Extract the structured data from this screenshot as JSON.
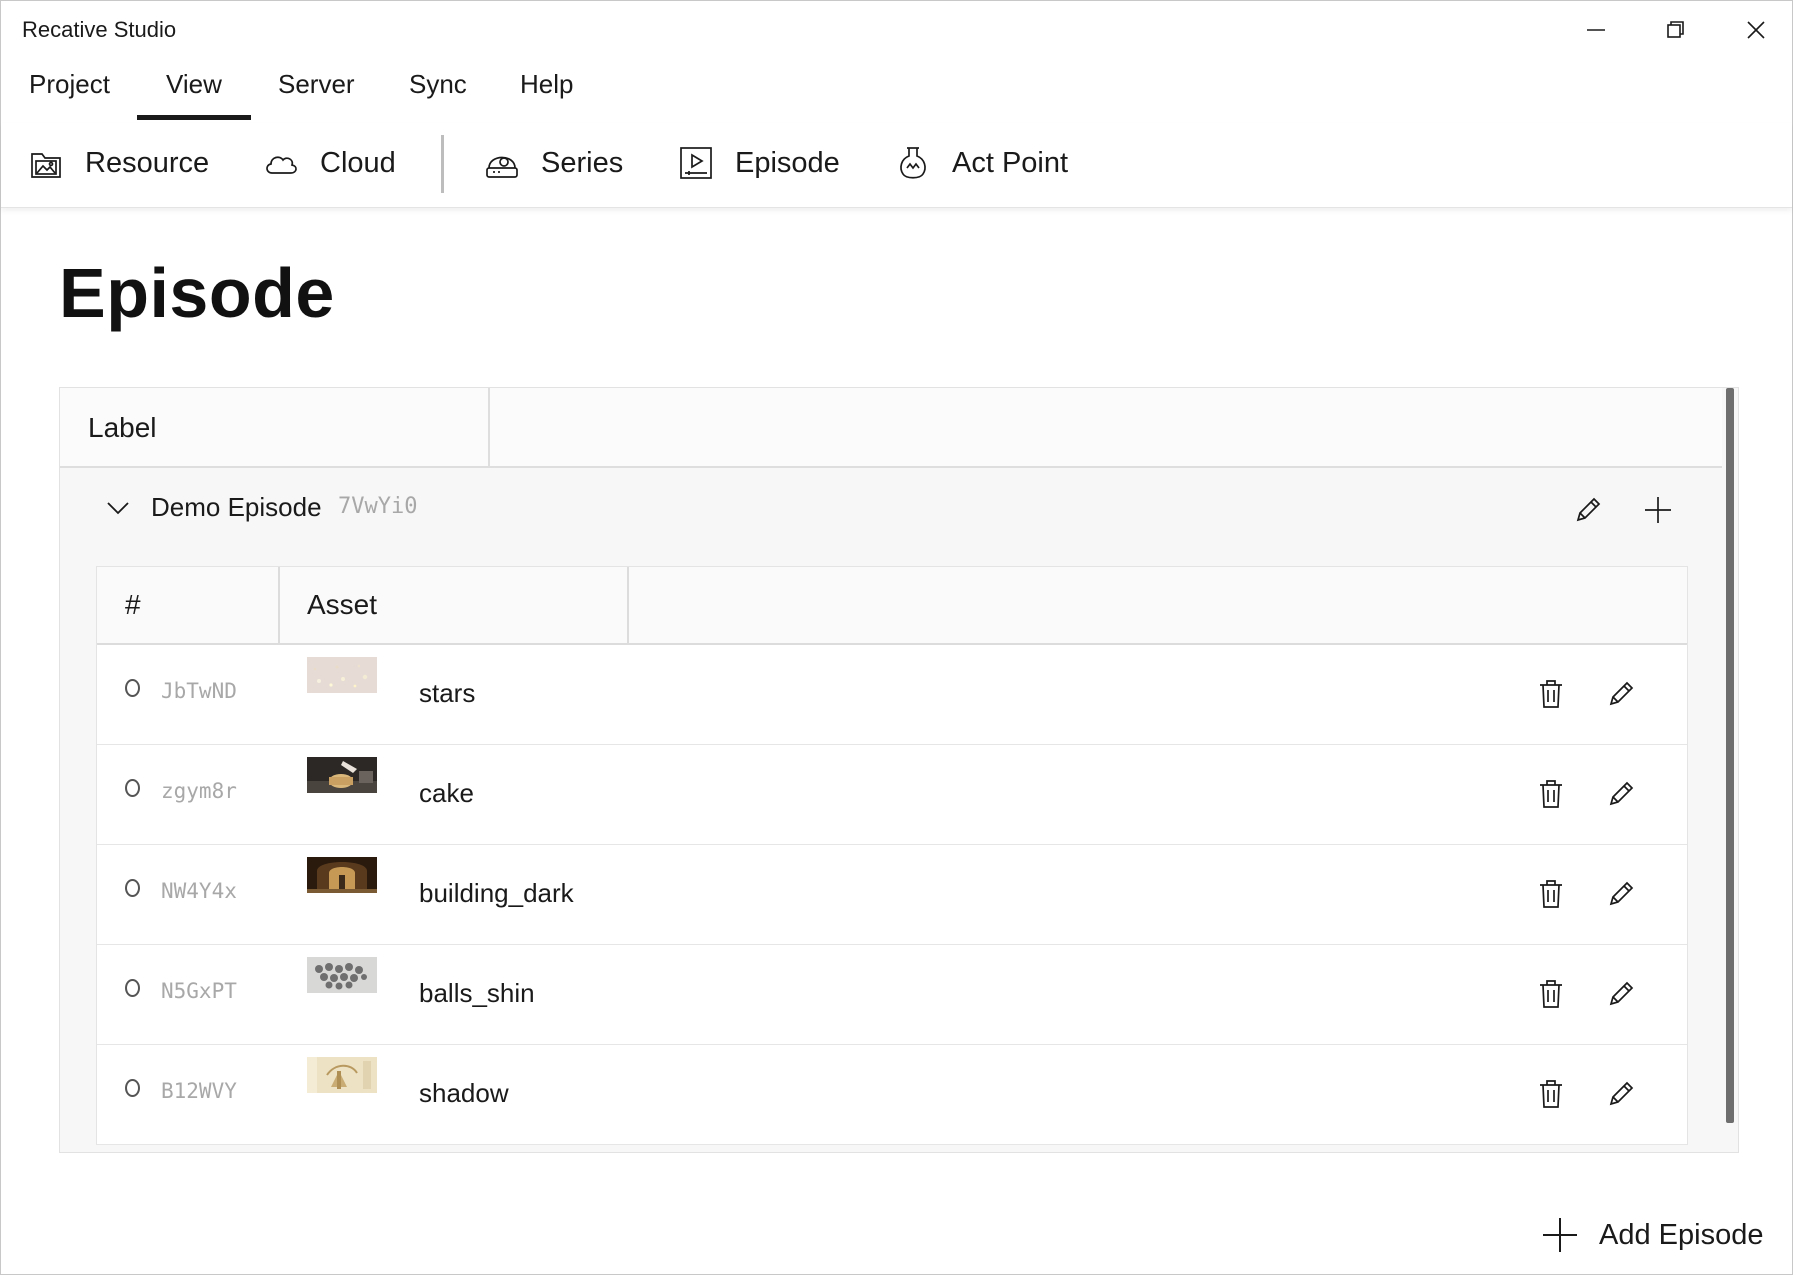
{
  "window": {
    "title": "Recative Studio"
  },
  "menu": {
    "items": [
      "Project",
      "View",
      "Server",
      "Sync",
      "Help"
    ],
    "active": "View"
  },
  "toolbar": {
    "resource": "Resource",
    "cloud": "Cloud",
    "series": "Series",
    "episode": "Episode",
    "act_point": "Act Point"
  },
  "page": {
    "title": "Episode"
  },
  "table": {
    "label_header": "Label"
  },
  "episode_group": {
    "label": "Demo Episode",
    "id": "7VwYi0",
    "columns": {
      "num": "#",
      "asset": "Asset"
    },
    "rows": [
      {
        "marker": "o",
        "id": "JbTwND",
        "asset": "stars",
        "thumb": "stars"
      },
      {
        "marker": "o",
        "id": "zgym8r",
        "asset": "cake",
        "thumb": "cake"
      },
      {
        "marker": "o",
        "id": "NW4Y4x",
        "asset": "building_dark",
        "thumb": "building"
      },
      {
        "marker": "o",
        "id": "N5GxPT",
        "asset": "balls_shin",
        "thumb": "balls"
      },
      {
        "marker": "o",
        "id": "B12WVY",
        "asset": "shadow",
        "thumb": "shadow"
      }
    ]
  },
  "footer": {
    "add_episode": "Add Episode"
  },
  "icons": {
    "toolbar": [
      "image-folder-icon",
      "cloud-icon",
      "series-icon",
      "video-play-icon",
      "flask-icon"
    ],
    "row_actions": [
      "trash-icon",
      "pencil-icon"
    ],
    "group_actions": [
      "pencil-icon",
      "plus-icon"
    ]
  }
}
